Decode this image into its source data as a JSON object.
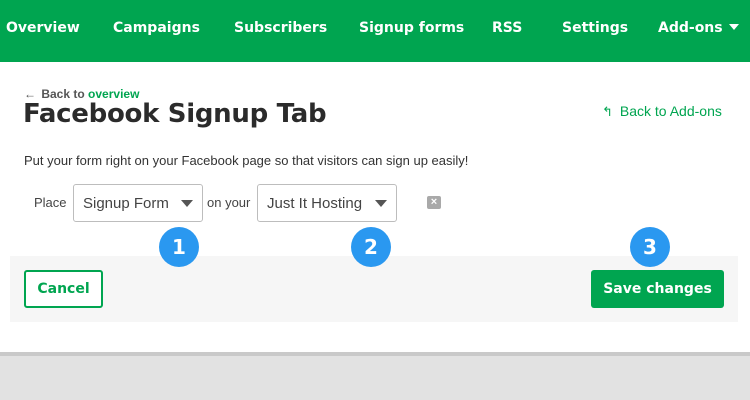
{
  "nav": {
    "items": [
      "Overview",
      "Campaigns",
      "Subscribers",
      "Signup forms",
      "RSS",
      "Settings",
      "Add-ons"
    ]
  },
  "header": {
    "back_prefix": "Back to",
    "back_link": "overview",
    "title": "Facebook Signup Tab",
    "back_addons": "Back to Add-ons"
  },
  "content": {
    "description": "Put your form right on your Facebook page so that visitors can sign up easily!",
    "place_label": "Place",
    "form_select": "Signup Form",
    "on_your_label": "on your",
    "page_select": "Just It Hosting"
  },
  "footer": {
    "cancel_label": "Cancel",
    "save_label": "Save changes"
  },
  "annotations": [
    "1",
    "2",
    "3"
  ],
  "icons": {
    "back_arrow": "arrow-left-icon",
    "back_addons": "reply-arrow-icon",
    "remove": "close-icon",
    "dropdown": "chevron-down-icon"
  },
  "colors": {
    "brand_green": "#00a550",
    "badge_blue": "#2a98f0"
  }
}
